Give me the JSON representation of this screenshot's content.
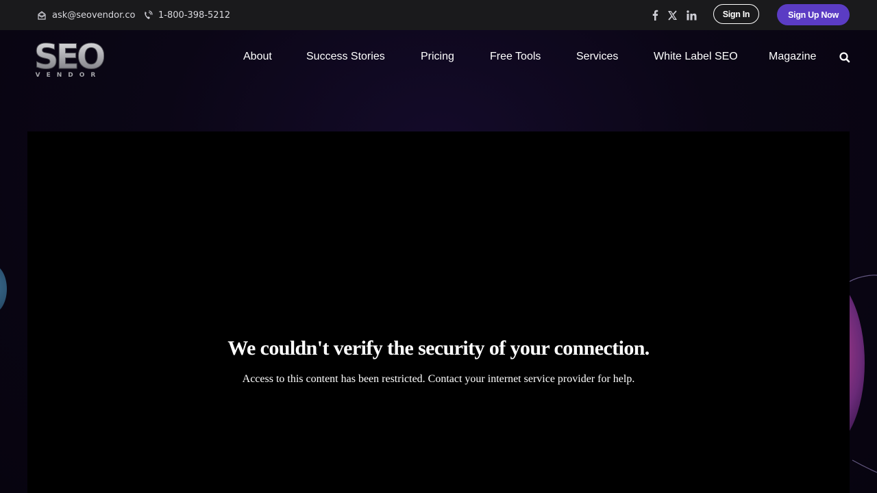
{
  "topbar": {
    "email": "ask@seovendor.co",
    "phone": "1-800-398-5212",
    "signin_label": "Sign In",
    "signup_label": "Sign Up Now",
    "social": [
      "facebook-icon",
      "x-icon",
      "linkedin-icon"
    ]
  },
  "logo": {
    "text_main": "SEO",
    "text_sub": "VENDOR"
  },
  "nav": {
    "items": [
      {
        "label": "About"
      },
      {
        "label": "Success Stories"
      },
      {
        "label": "Pricing"
      },
      {
        "label": "Free Tools"
      },
      {
        "label": "Services"
      },
      {
        "label": "White Label SEO"
      },
      {
        "label": "Magazine"
      }
    ],
    "search_icon": "search-icon"
  },
  "message": {
    "title": "We couldn't verify the security of your connection.",
    "body": "Access to this content has been restricted. Contact your internet service provider for help."
  },
  "colors": {
    "accent": "#5b3cc4",
    "topbar_bg": "#1a1a1c",
    "panel_bg": "#000000"
  }
}
